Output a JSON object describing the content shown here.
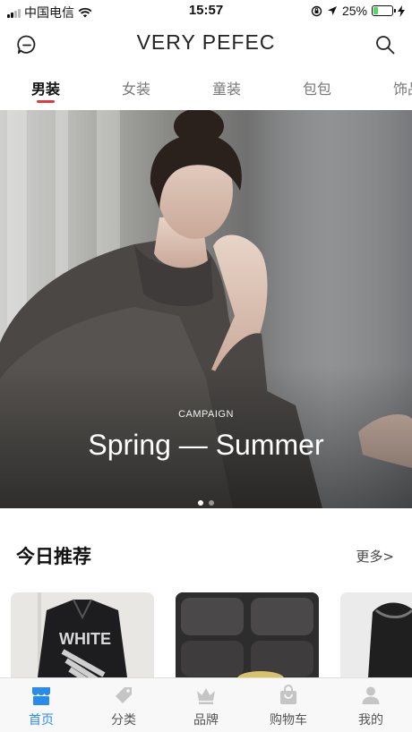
{
  "status_bar": {
    "carrier": "中国电信",
    "time": "15:57",
    "battery_percent_label": "25%",
    "battery_level": 0.25
  },
  "header": {
    "title": "VERY PEFEC",
    "left_icon": "message-icon",
    "right_icon": "search-icon"
  },
  "tabs": [
    {
      "label": "男装"
    },
    {
      "label": "女装"
    },
    {
      "label": "童装"
    },
    {
      "label": "包包"
    },
    {
      "label": "饰品"
    }
  ],
  "tabs_active_index": 0,
  "banner": {
    "kicker": "CAMPAIGN",
    "title": "Spring — Summer",
    "page_count": 2,
    "active_page": 0
  },
  "recommend": {
    "title": "今日推荐",
    "more_label": "更多>"
  },
  "products": [
    {
      "image": "white-leather-jacket"
    },
    {
      "image": "leather-sofa"
    },
    {
      "image": "fur-coat"
    }
  ],
  "tabbar": {
    "items": [
      {
        "label": "首页",
        "icon": "home-store-icon"
      },
      {
        "label": "分类",
        "icon": "tag-icon"
      },
      {
        "label": "品牌",
        "icon": "crown-icon"
      },
      {
        "label": "购物车",
        "icon": "shopping-bag-icon"
      },
      {
        "label": "我的",
        "icon": "user-icon"
      }
    ],
    "active_index": 0
  },
  "colors": {
    "accent_red": "#e0393e",
    "accent_blue": "#2a8be8",
    "battery_green": "#4cd964"
  }
}
